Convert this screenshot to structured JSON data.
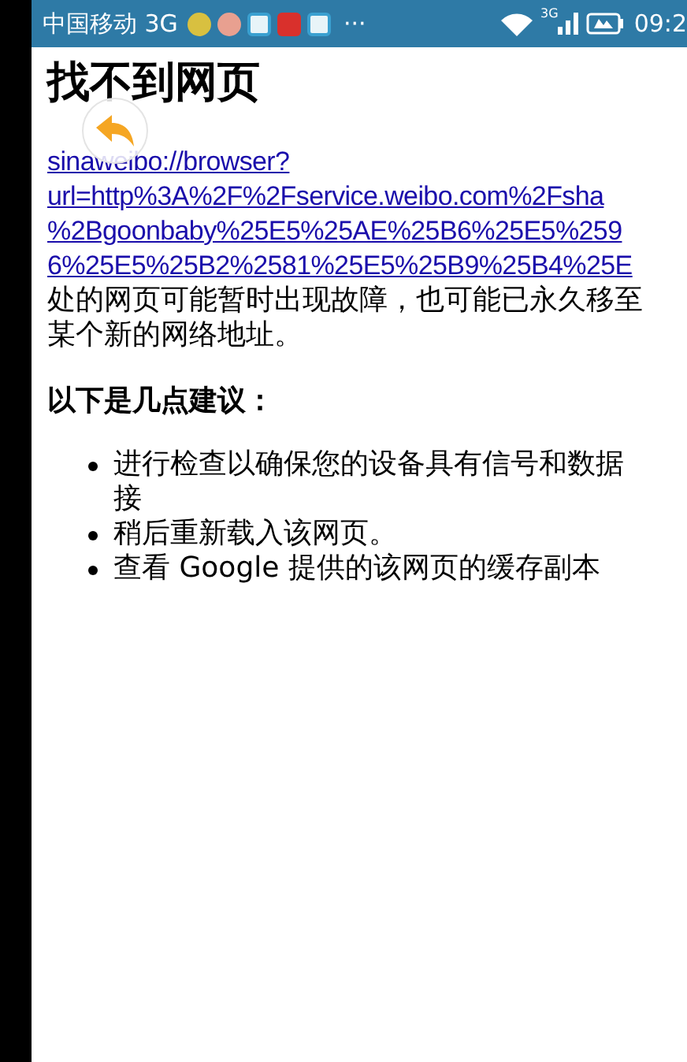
{
  "status_bar": {
    "carrier": "中国移动 3G",
    "more": "···",
    "network": "3G",
    "time": "09:2"
  },
  "page": {
    "title": "找不到网页",
    "link_lines": [
      "sinaweibo://browser?",
      "url=http%3A%2F%2Fservice.weibo.com%2Fsha",
      "%2Bgoonbaby%25E5%25AE%25B6%25E5%259",
      "6%25E5%25B2%2581%25E5%25B9%25B4%25E"
    ],
    "message_lines": [
      "处的网页可能暂时出现故障，也可能已永久移至",
      "某个新的网络地址。"
    ],
    "suggestions_title": "以下是几点建议：",
    "suggestions": [
      {
        "lines": [
          "进行检查以确保您的设备具有信号和数据",
          "接"
        ]
      },
      {
        "lines": [
          "稍后重新载入该网页。"
        ]
      },
      {
        "lines": [
          "查看 Google 提供的该网页的缓存副本"
        ]
      }
    ]
  }
}
